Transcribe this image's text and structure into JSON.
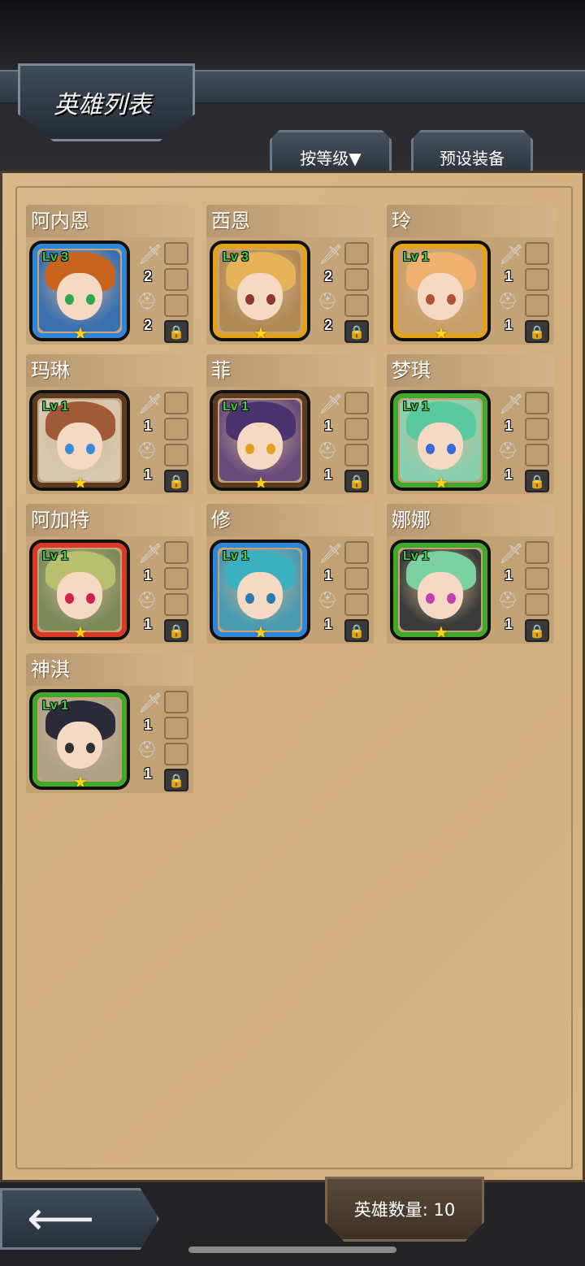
{
  "header": {
    "title": "英雄列表"
  },
  "tabs": {
    "sort_label": "按等级▼",
    "preset_label": "预设装备"
  },
  "heroes": [
    {
      "name": "阿内恩",
      "level": "Lv 3",
      "attack": "2",
      "defense": "2",
      "frame_color": "#2f86d8",
      "hair": "#c8641e",
      "eye": "#2ea84a",
      "bg": "#3a6fb0"
    },
    {
      "name": "西恩",
      "level": "Lv 3",
      "attack": "2",
      "defense": "2",
      "frame_color": "#e3a21a",
      "hair": "#e6b25a",
      "eye": "#8a3a2a",
      "bg": "#b08a54"
    },
    {
      "name": "玲",
      "level": "Lv 1",
      "attack": "1",
      "defense": "1",
      "frame_color": "#e3a21a",
      "hair": "#f0b070",
      "eye": "#b0533a",
      "bg": "#c9a06b"
    },
    {
      "name": "玛琳",
      "level": "Lv 1",
      "attack": "1",
      "defense": "1",
      "frame_color": "#5a3a20",
      "hair": "#a05a35",
      "eye": "#3a8ad8",
      "bg": "#d8c8b0"
    },
    {
      "name": "菲",
      "level": "Lv 1",
      "attack": "1",
      "defense": "1",
      "frame_color": "#5a3a20",
      "hair": "#4a3470",
      "eye": "#e0a020",
      "bg": "#6a4a7a"
    },
    {
      "name": "梦琪",
      "level": "Lv 1",
      "attack": "1",
      "defense": "1",
      "frame_color": "#3fa82a",
      "hair": "#5ac9a0",
      "eye": "#3a6ad8",
      "bg": "#8ad0b0"
    },
    {
      "name": "阿加特",
      "level": "Lv 1",
      "attack": "1",
      "defense": "1",
      "frame_color": "#d83a2a",
      "hair": "#b8c070",
      "eye": "#d02050",
      "bg": "#7a8a5a"
    },
    {
      "name": "修",
      "level": "Lv 1",
      "attack": "1",
      "defense": "1",
      "frame_color": "#2f86d8",
      "hair": "#3ab0c0",
      "eye": "#2a7ab0",
      "bg": "#4a9ab0"
    },
    {
      "name": "娜娜",
      "level": "Lv 1",
      "attack": "1",
      "defense": "1",
      "frame_color": "#3fa82a",
      "hair": "#7ad0a0",
      "eye": "#c040b0",
      "bg": "#3a3a3a"
    },
    {
      "name": "神淇",
      "level": "Lv 1",
      "attack": "1",
      "defense": "1",
      "frame_color": "#3fa82a",
      "hair": "#2a2a38",
      "eye": "#303030",
      "bg": "#b0a08a"
    }
  ],
  "footer": {
    "hero_count_label": "英雄数量: 10"
  },
  "icons": {
    "back": "arrow-left-icon",
    "attack": "sword-icon",
    "defense": "helmet-icon",
    "lock": "lock-icon",
    "rank": "star-icon"
  }
}
